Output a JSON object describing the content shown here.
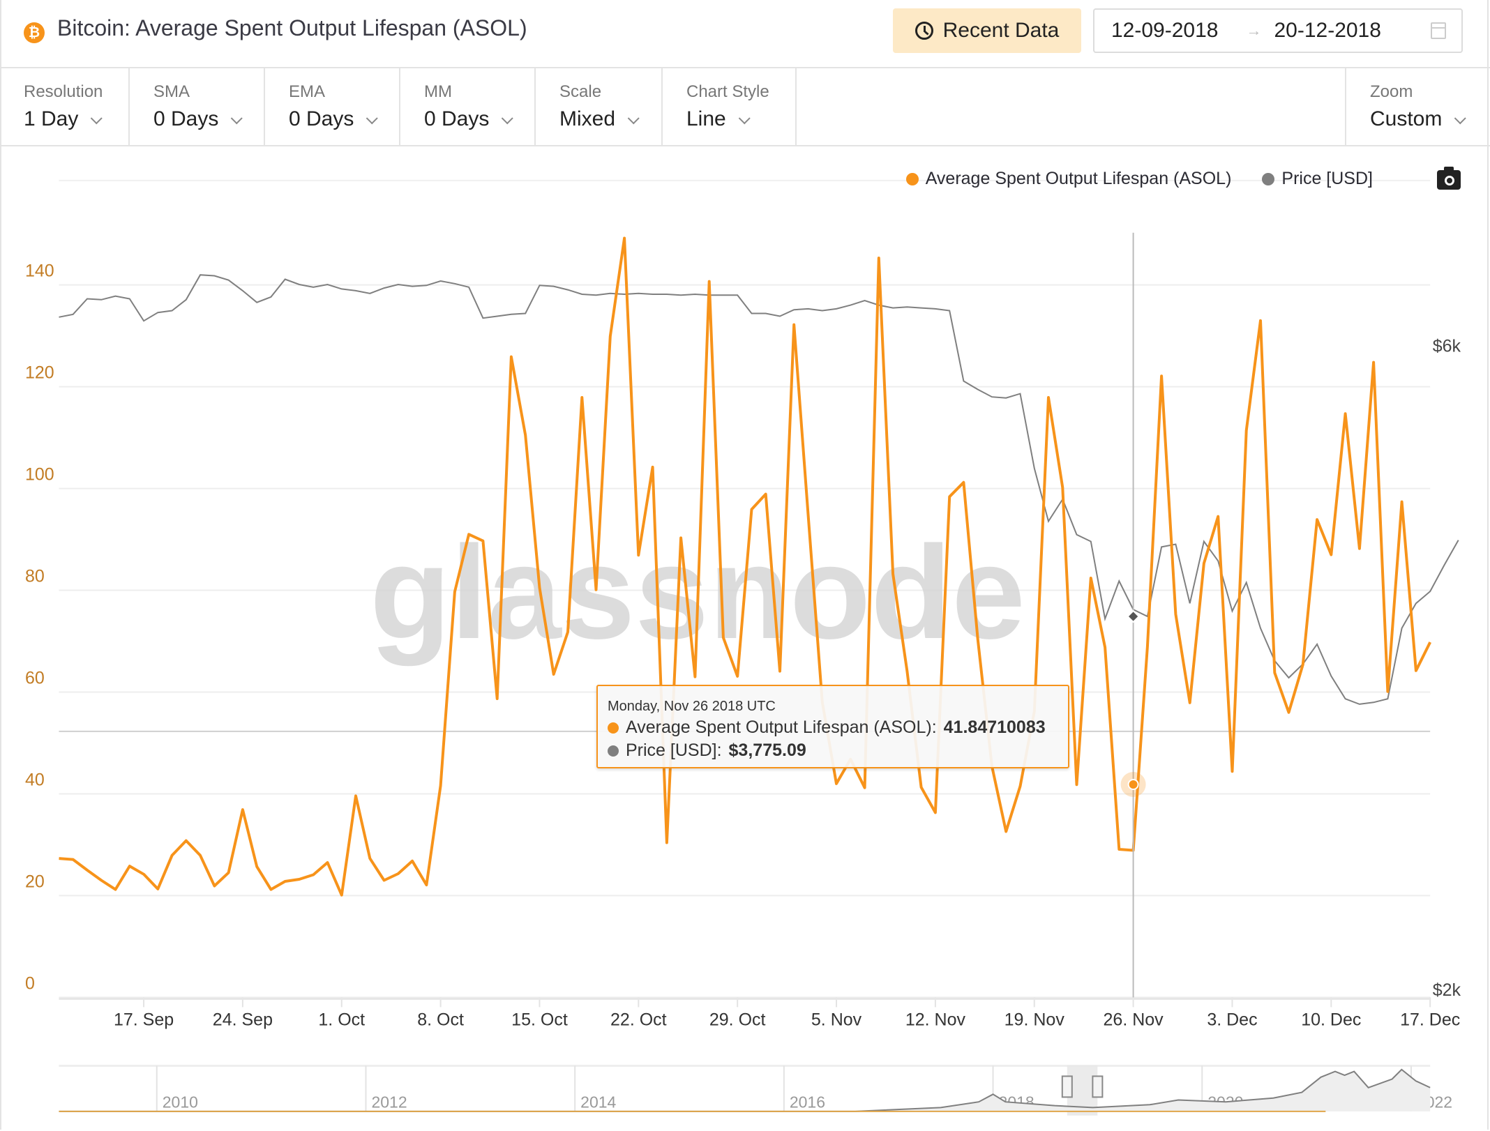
{
  "header": {
    "title": "Bitcoin: Average Spent Output Lifespan (ASOL)",
    "recent_button": "Recent Data",
    "date_start": "12-09-2018",
    "date_arrow": "→",
    "date_end": "20-12-2018"
  },
  "toolbar": {
    "controls": [
      {
        "label": "Resolution",
        "value": "1 Day"
      },
      {
        "label": "SMA",
        "value": "0 Days"
      },
      {
        "label": "EMA",
        "value": "0 Days"
      },
      {
        "label": "MM",
        "value": "0 Days"
      },
      {
        "label": "Scale",
        "value": "Mixed"
      },
      {
        "label": "Chart Style",
        "value": "Line"
      }
    ],
    "zoom": {
      "label": "Zoom",
      "value": "Custom"
    }
  },
  "legend": {
    "asol": "Average Spent Output Lifespan (ASOL)",
    "price": "Price [USD]"
  },
  "colors": {
    "asol": "#f7931a",
    "price": "#7f7f7f",
    "axis_left": "#c27c24",
    "recent_bg": "#fde9c6"
  },
  "watermark": "glassnode",
  "tooltip": {
    "date": "Monday, Nov 26 2018 UTC",
    "asol_label": "Average Spent Output Lifespan (ASOL):",
    "asol_value": "41.84710083",
    "price_label": "Price [USD]:",
    "price_value": "$3,775.09"
  },
  "navigator": {
    "years": [
      "2010",
      "2012",
      "2014",
      "2016",
      "2018",
      "2020",
      "2022"
    ]
  },
  "chart_data": {
    "type": "line",
    "title": "Bitcoin: Average Spent Output Lifespan (ASOL)",
    "xlabel": "",
    "ylabel": "",
    "x_start": "2018-09-11",
    "x_end": "2018-12-20",
    "x_ticks": [
      "17. Sep",
      "24. Sep",
      "1. Oct",
      "8. Oct",
      "15. Oct",
      "22. Oct",
      "29. Oct",
      "5. Nov",
      "12. Nov",
      "19. Nov",
      "26. Nov",
      "3. Dec",
      "10. Dec",
      "17. Dec"
    ],
    "y_left_ticks": [
      "0",
      "20",
      "40",
      "60",
      "80",
      "100",
      "120",
      "140"
    ],
    "y_left_range": [
      0,
      150
    ],
    "y_right_ticks": [
      "$2k",
      "$6k"
    ],
    "y_right_scale": "log",
    "grid": true,
    "legend_position": "top-right",
    "hover_date": "2018-11-26",
    "series": [
      {
        "name": "Average Spent Output Lifespan (ASOL)",
        "axis": "left",
        "values": [
          27.3,
          27.1,
          25,
          23,
          21.2,
          25.8,
          24.2,
          21.3,
          27.9,
          30.8,
          27.9,
          21.9,
          24.5,
          36.9,
          25.7,
          21.2,
          22.8,
          23.2,
          24.1,
          26.5,
          20.1,
          39.6,
          27.3,
          23,
          24.3,
          26.8,
          22.1,
          41.6,
          79.7,
          91.0,
          89.7,
          58.7,
          125.9,
          110.5,
          80.5,
          63.5,
          71.8,
          117.9,
          80.1,
          129.9,
          149.2,
          86.9,
          104.2,
          30.4,
          90.3,
          63.0,
          140.7,
          70.7,
          63.1,
          95.9,
          98.9,
          64.1,
          132.2,
          94.9,
          58.0,
          42.0,
          46.8,
          41.2,
          145.3,
          83.2,
          64.1,
          41.3,
          36.3,
          98.4,
          101.2,
          70.4,
          45.4,
          32.6,
          41.5,
          56.2,
          117.9,
          100.2,
          41.8,
          82.4,
          68.8,
          29.1,
          28.9,
          68.9,
          122.1,
          75.3,
          57.9,
          85.3,
          94.5,
          44.4,
          111.4,
          133.0,
          63.8,
          56.0,
          65.4,
          93.9,
          87.0,
          114.7,
          88.2,
          124.8,
          60.1,
          97.4,
          64.2,
          69.8
        ]
      },
      {
        "name": "Price [USD]",
        "axis": "right",
        "values": [
          6290,
          6320,
          6490,
          6480,
          6520,
          6490,
          6250,
          6340,
          6360,
          6480,
          6760,
          6750,
          6700,
          6580,
          6450,
          6510,
          6710,
          6650,
          6620,
          6650,
          6600,
          6580,
          6550,
          6610,
          6650,
          6630,
          6640,
          6690,
          6660,
          6620,
          6280,
          6300,
          6320,
          6330,
          6640,
          6630,
          6590,
          6540,
          6530,
          6550,
          6540,
          6550,
          6540,
          6540,
          6530,
          6540,
          6530,
          6530,
          6530,
          6330,
          6330,
          6300,
          6370,
          6380,
          6360,
          6380,
          6420,
          6470,
          6420,
          6390,
          6400,
          6390,
          6380,
          6360,
          5640,
          5560,
          5490,
          5480,
          5520,
          4860,
          4440,
          4610,
          4340,
          4290,
          3760,
          4010,
          3820,
          3775,
          4250,
          4270,
          3860,
          4290,
          4150,
          3810,
          4000,
          3700,
          3500,
          3400,
          3480,
          3600,
          3410,
          3280,
          3250,
          3260,
          3280,
          3700,
          3860,
          3940,
          4120,
          4300
        ]
      }
    ]
  }
}
